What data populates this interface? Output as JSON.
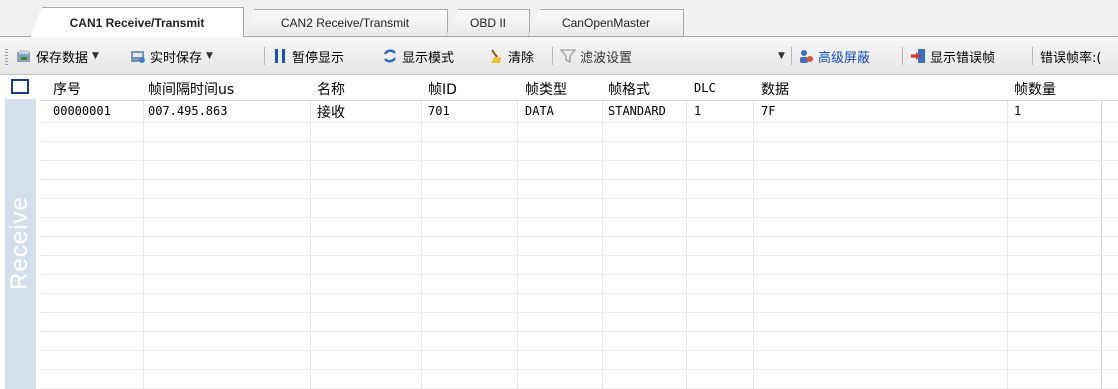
{
  "tabs": [
    {
      "label": "CAN1 Receive/Transmit",
      "active": true
    },
    {
      "label": "CAN2 Receive/Transmit",
      "active": false
    },
    {
      "label": "OBD II",
      "active": false
    },
    {
      "label": "CanOpenMaster",
      "active": false
    }
  ],
  "toolbar": {
    "save_data": "保存数据",
    "realtime_save": "实时保存",
    "pause_display": "暂停显示",
    "display_mode": "显示模式",
    "clear": "清除",
    "filter_settings": "滤波设置",
    "advanced_mask": "高级屏蔽",
    "show_error_frames": "显示错误帧",
    "error_frame_rate": "错误帧率:("
  },
  "sidebar": {
    "label": "Receive"
  },
  "table": {
    "columns": [
      "序号",
      "帧间隔时间us",
      "名称",
      "帧ID",
      "帧类型",
      "帧格式",
      "DLC",
      "数据",
      "帧数量"
    ],
    "rows": [
      [
        "00000001",
        "007.495.863",
        "接收",
        "701",
        "DATA",
        "STANDARD",
        "1",
        "7F",
        "1"
      ]
    ]
  },
  "colors": {
    "accent": "#1f3c86",
    "sidebar": "#d5dfeb",
    "link": "#1a4fb5"
  }
}
